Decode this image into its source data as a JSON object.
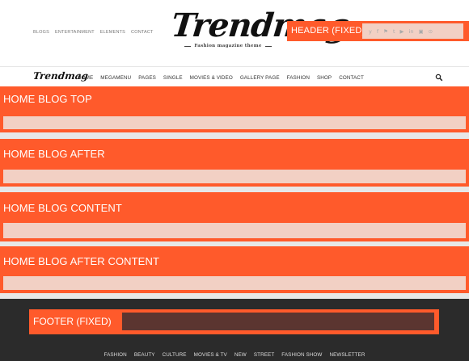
{
  "top_links": [
    "BLOGS",
    "ENTERTAINMENT",
    "ELEMENTS",
    "CONTACT"
  ],
  "logo": {
    "title": "Trendmag",
    "tagline": "Fashion magazine theme"
  },
  "header_fixed": {
    "label": "HEADER (FIXED)",
    "social_icons": [
      "twitter-icon",
      "facebook-icon",
      "rss-icon",
      "tumblr-icon",
      "youtube-icon",
      "linkedin-icon",
      "instagram-icon",
      "pinterest-icon"
    ],
    "social_glyphs": [
      "y",
      "f",
      "⚑",
      "t",
      "▶",
      "in",
      "▣",
      "⊙"
    ]
  },
  "main_nav": {
    "logo": "Trendmag",
    "items": [
      "HOME",
      "MEGAMENU",
      "PAGES",
      "SINGLE",
      "MOVIES & VIDEO",
      "GALLERY PAGE",
      "FASHION",
      "SHOP",
      "CONTACT"
    ],
    "search_icon": "search-icon"
  },
  "blocks": [
    {
      "label": "HOME BLOG TOP"
    },
    {
      "label": "HOME BLOG AFTER"
    },
    {
      "label": "HOME BLOG CONTENT"
    },
    {
      "label": "HOME BLOG AFTER CONTENT"
    }
  ],
  "footer": {
    "fixed_label": "FOOTER (FIXED)",
    "links": [
      "FASHION",
      "BEAUTY",
      "CULTURE",
      "MOVIES & TV",
      "NEW",
      "STREET",
      "FASHION SHOW",
      "NEWSLETTER"
    ]
  },
  "colors": {
    "accent": "#ff5a2b",
    "block_fill": "#f2d0c4",
    "footer_bg": "#2b2b2b",
    "footer_inner": "#5b3530"
  }
}
